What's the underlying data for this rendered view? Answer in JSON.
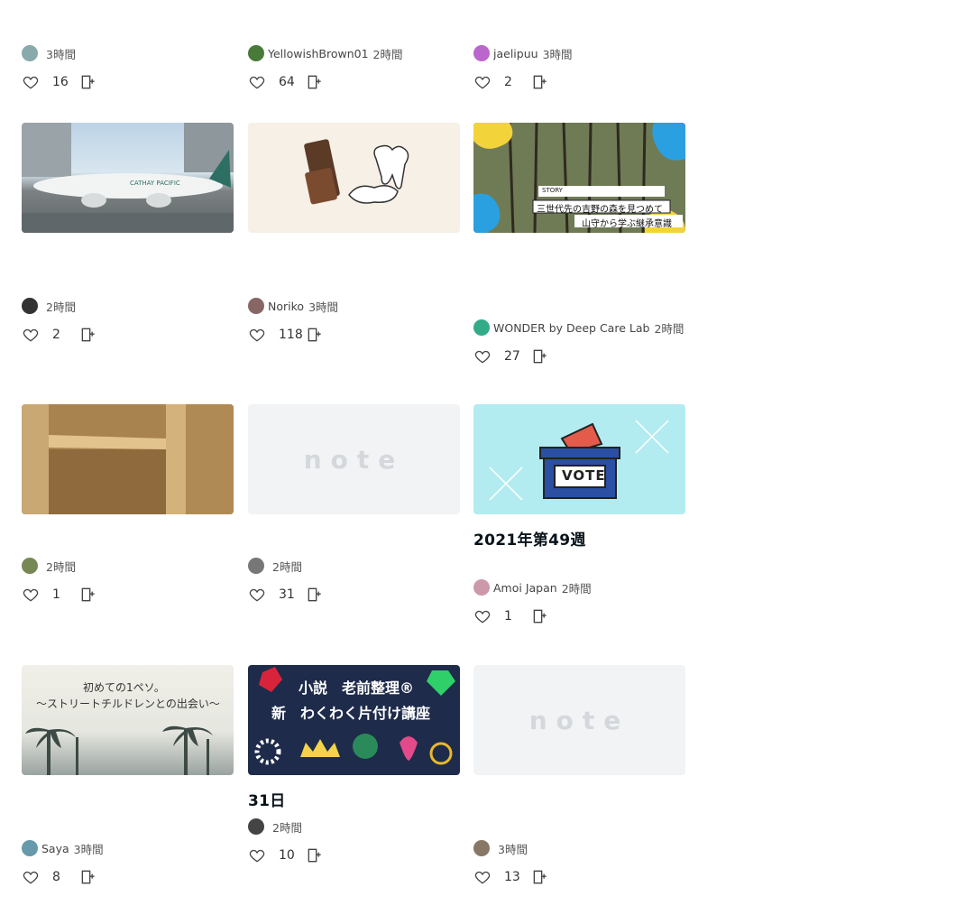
{
  "rows": [
    [
      {
        "title": "",
        "author": "",
        "time": "3時間",
        "likes": "16",
        "thumb": "none",
        "avatar": "#8aa"
      },
      {
        "title": "",
        "author": "YellowishBrown01",
        "time": "2時間",
        "likes": "64",
        "thumb": "none",
        "avatar": "#4a7a3a"
      },
      {
        "title": "",
        "author": "jaelipuu",
        "time": "3時間",
        "likes": "2",
        "thumb": "none",
        "avatar": "#b6c"
      }
    ],
    [
      {
        "title": "",
        "author": "",
        "time": "2時間",
        "likes": "2",
        "thumb": "plane",
        "avatar": "#333"
      },
      {
        "title": "",
        "author": "Noriko",
        "time": "3時間",
        "likes": "118",
        "thumb": "teeth",
        "avatar": "#866"
      },
      {
        "title": "",
        "author": "WONDER by Deep Care Lab",
        "time": "2時間",
        "likes": "27",
        "thumb": "forest",
        "avatar": "#3a8"
      }
    ],
    [
      {
        "title": "",
        "author": "",
        "time": "2時間",
        "likes": "1",
        "thumb": "shelf",
        "avatar": "#785"
      },
      {
        "title": "",
        "author": "",
        "time": "2時間",
        "likes": "31",
        "thumb": "note",
        "avatar": "#777"
      },
      {
        "title": "2021年第49週",
        "author": "Amoi Japan",
        "time": "2時間",
        "likes": "1",
        "thumb": "vote",
        "avatar": "#c9a"
      }
    ],
    [
      {
        "title": "",
        "author": "Saya",
        "time": "3時間",
        "likes": "8",
        "thumb": "palm",
        "avatar": "#69a"
      },
      {
        "title": "31日",
        "author": "",
        "time": "2時間",
        "likes": "10",
        "thumb": "tidy",
        "avatar": "#444"
      },
      {
        "title": "",
        "author": "",
        "time": "3時間",
        "likes": "13",
        "thumb": "note",
        "avatar": "#876"
      }
    ]
  ],
  "thumb_text": {
    "plane": "CATHAY PACIFIC",
    "forest_line1": "STORY",
    "forest_line2": "三世代先の吉野の森を見つめて",
    "forest_line3": "山守から学ぶ継承意識",
    "vote": "VOTE",
    "palm_line1": "初めての1ペソ。",
    "palm_line2": "〜ストリートチルドレンとの出会い〜",
    "tidy_line1": "小説　老前整理®",
    "tidy_line2": "新　わくわく片付け講座",
    "note_logo": "note"
  }
}
